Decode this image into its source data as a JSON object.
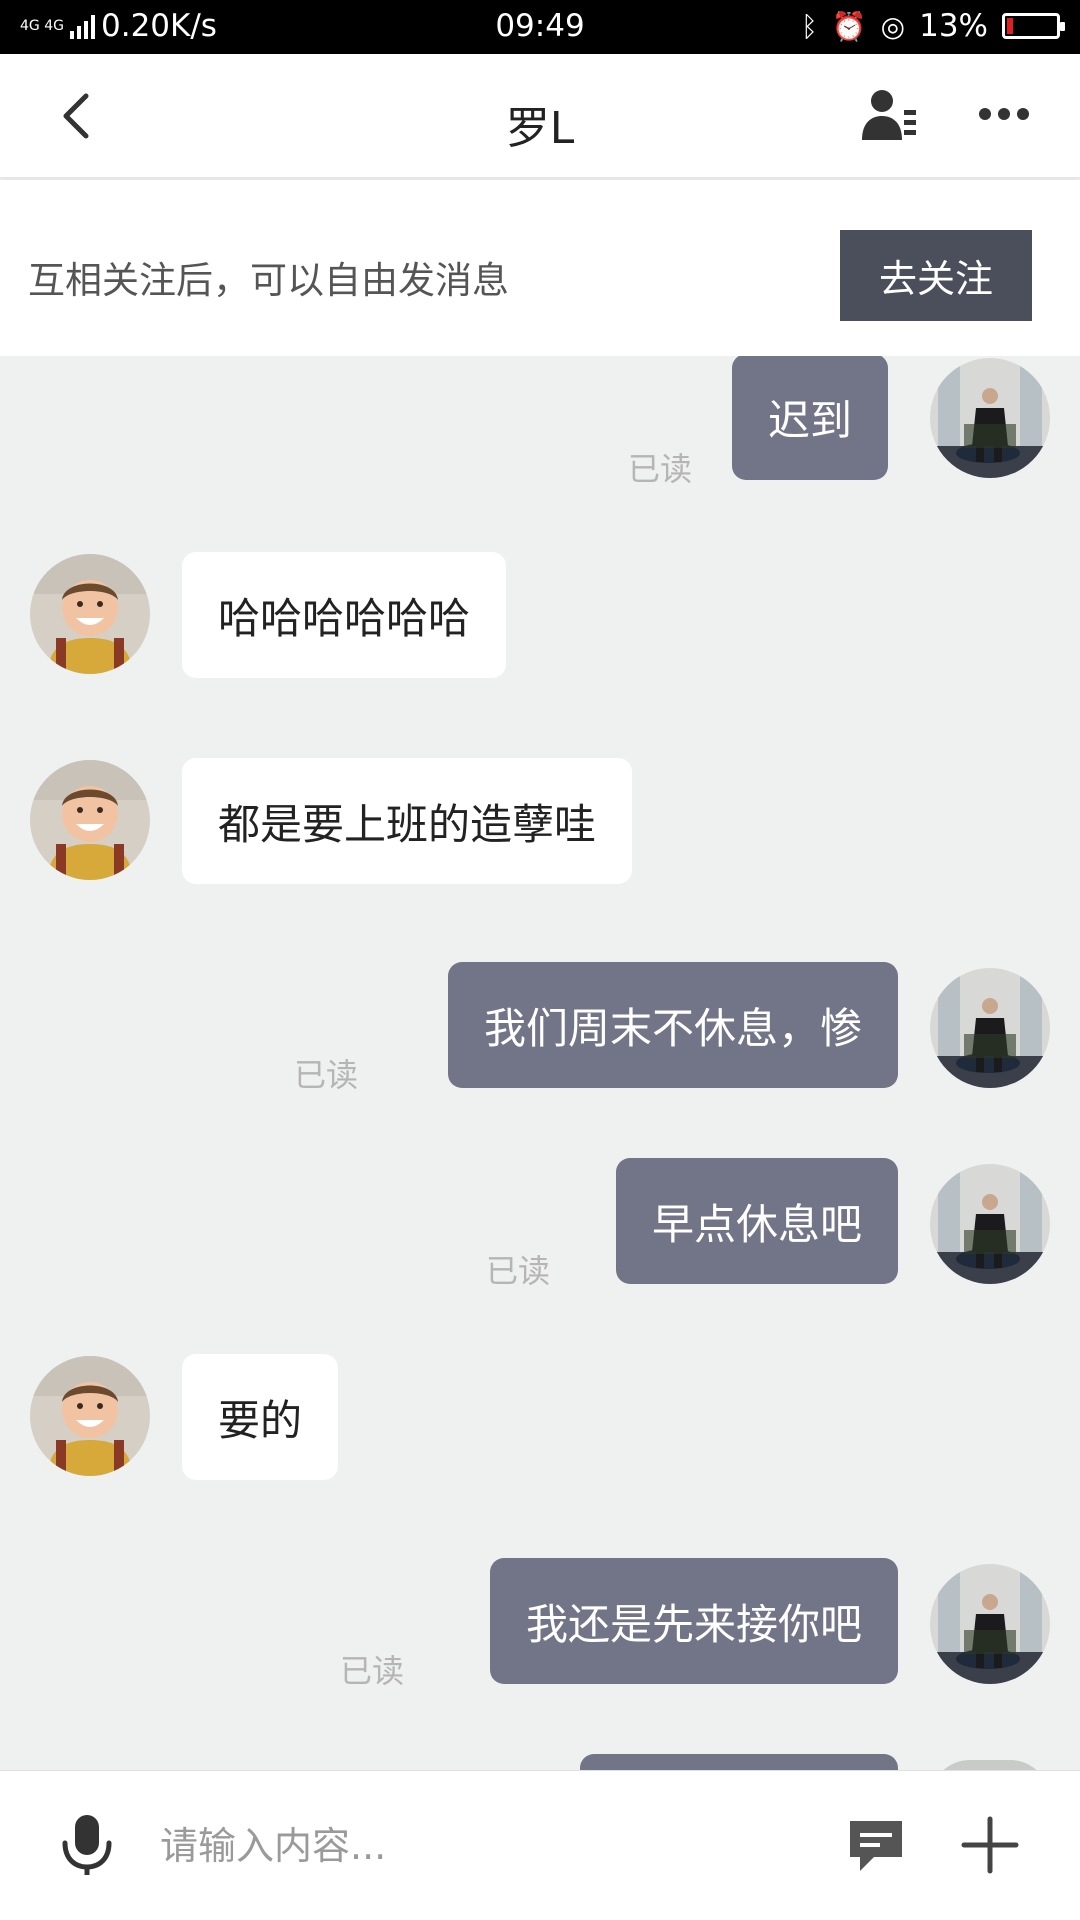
{
  "status_bar": {
    "network_type": "4G 4G",
    "speed": "0.20K/s",
    "time": "09:49",
    "battery": "13%",
    "battery_level": 0.13
  },
  "header": {
    "back_icon": "chevron-left-icon",
    "title": "罗L",
    "profile_icon": "user-detail-icon",
    "more_icon": "more-dots-icon"
  },
  "banner": {
    "text": "互相关注后，可以自由发消息",
    "button_label": "去关注"
  },
  "messages": [
    {
      "side": "out",
      "text": "迟到",
      "status": "已读"
    },
    {
      "side": "in",
      "text": "哈哈哈哈哈哈"
    },
    {
      "side": "in",
      "text": "都是要上班的造孽哇"
    },
    {
      "side": "out",
      "text": "我们周末不休息，惨",
      "status": "已读"
    },
    {
      "side": "out",
      "text": "早点休息吧",
      "status": "已读"
    },
    {
      "side": "in",
      "text": "要的"
    },
    {
      "side": "out",
      "text": "我还是先来接你吧",
      "status": "已读"
    }
  ],
  "input_bar": {
    "voice_icon": "microphone-icon",
    "placeholder": "请输入内容...",
    "quick_reply_icon": "chat-bubble-icon",
    "more_icon": "plus-icon"
  },
  "colors": {
    "outgoing_bubble": "#727587",
    "incoming_bubble": "#ffffff",
    "background": "#eff0f0",
    "follow_button": "#4a4f5b",
    "battery_low": "#e02020"
  }
}
